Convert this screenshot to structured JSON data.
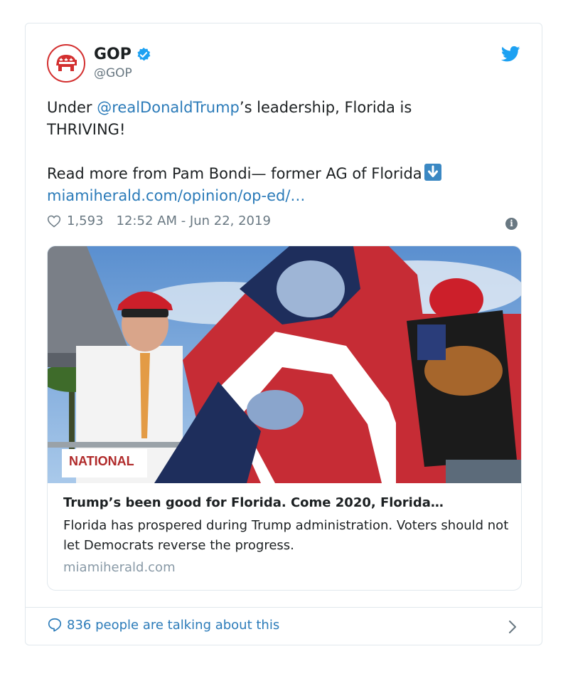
{
  "tweet": {
    "display_name": "GOP",
    "handle": "@GOP",
    "text_before_mention": "Under ",
    "mention": "@realDonaldTrump",
    "text_after_mention": "’s leadership, Florida is\nTHRIVING!\n\nRead more from Pam Bondi— former AG of Florida",
    "link": "miamiherald.com/opinion/op-ed/…",
    "likes": "1,593",
    "timestamp": "12:52 AM - Jun 22, 2019"
  },
  "link_card": {
    "title": "Trump’s been good for Florida. Come 2020, Florida…",
    "description": "Florida has prospered during Trump administration. Voters should not let Democrats reverse the progress.",
    "domain": "miamiherald.com",
    "photo_sign_text": "NATIONAL"
  },
  "footer": {
    "talking": "836 people are talking about this"
  },
  "colors": {
    "link": "#2b7bb9",
    "secondary_text": "#697882",
    "twitter_blue": "#1da1f2",
    "gop_red": "#d32f2f"
  },
  "icons": [
    "gop-logo-icon",
    "verified-badge-icon",
    "twitter-bird-icon",
    "heart-icon",
    "info-icon",
    "down-arrow-emoji-icon",
    "speech-bubble-icon",
    "chevron-right-icon"
  ]
}
